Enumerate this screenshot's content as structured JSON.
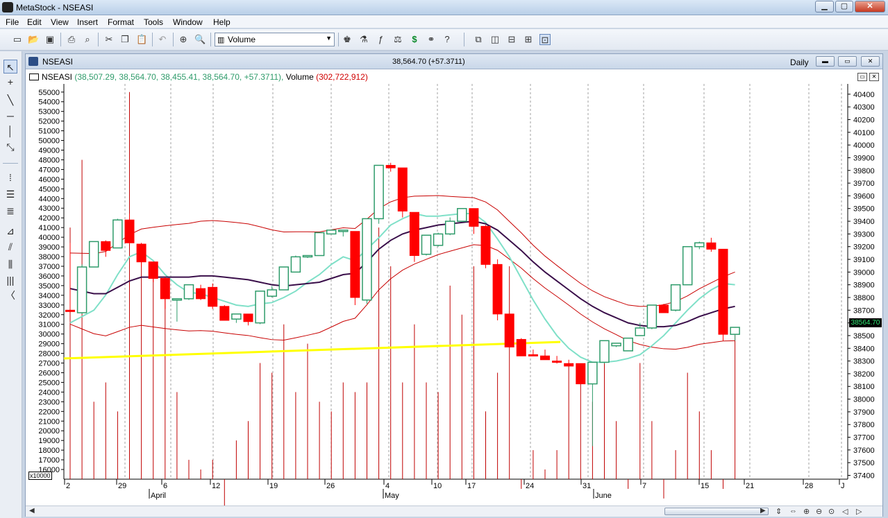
{
  "window": {
    "title": "MetaStock - NSEASI",
    "minimize_label": "▁",
    "maximize_label": "▢",
    "close_label": "✕"
  },
  "menu": [
    "File",
    "Edit",
    "View",
    "Insert",
    "Format",
    "Tools",
    "Window",
    "Help"
  ],
  "toolbar": {
    "indicator_select": "Volume",
    "icons": [
      "new-icon",
      "open-icon",
      "save-icon",
      "print-icon",
      "print-preview-icon",
      "cut-icon",
      "copy-icon",
      "paste-icon",
      "undo-icon",
      "crosshair-icon",
      "zoom-icon",
      "expert-advisor-icon",
      "explorer-icon",
      "formula-icon",
      "system-tester-icon",
      "dollar-icon",
      "binoculars-icon",
      "help-pointer-icon",
      "cascade-icon",
      "tile-vertical-icon",
      "tile-horizontal-icon",
      "tile-grid-icon",
      "arrange-icon"
    ]
  },
  "sidebar_tools": [
    "pointer-icon",
    "crosshair-tool-icon",
    "trendline-icon",
    "horizontal-line-icon",
    "vertical-line-icon",
    "speed-line-icon",
    "fibonacci-icon",
    "channel-icon",
    "gann-icon",
    "andrews-pitchfork-icon",
    "quadrant-icon",
    "cycle-lines-icon",
    "arc-icon"
  ],
  "chart_window": {
    "security": "NSEASI",
    "quote": "38,564.70 (+57.3711)",
    "period": "Daily",
    "legend": {
      "name": "NSEASI",
      "ohlc": "(38,507.29, 38,564.70, 38,455.41, 38,564.70, +57.3711),",
      "volume_label": "Volume",
      "volume_value": "(302,722,912)"
    },
    "last_price_tag": "38564.70",
    "volume_scale_label": "x10000"
  },
  "colors": {
    "up_candle": "#2e9b6a",
    "down_candle": "#ff0000",
    "volume": "#c00000",
    "bollinger": "#c80000",
    "ma_fast": "#7fe0c8",
    "ma_slow": "#3a0f4a",
    "trendline": "#ffff00",
    "grid": "#a0a0a0"
  },
  "chart_data": {
    "type": "candlestick",
    "left_axis": {
      "label": "Volume (x10000)",
      "ticks": [
        55000,
        54000,
        53000,
        52000,
        51000,
        50000,
        49000,
        48000,
        47000,
        46000,
        45000,
        44000,
        43000,
        42000,
        41000,
        40000,
        39000,
        38000,
        37000,
        36000,
        35000,
        34000,
        33000,
        32000,
        31000,
        30000,
        29000,
        28000,
        27000,
        26000,
        25000,
        24000,
        23000,
        22000,
        21000,
        20000,
        19000,
        18000,
        17000,
        16000
      ]
    },
    "right_axis": {
      "label": "Price",
      "ticks": [
        40400,
        40300,
        40200,
        40100,
        40000,
        39900,
        39800,
        39700,
        39600,
        39500,
        39400,
        39300,
        39200,
        39100,
        39000,
        38900,
        38800,
        38700,
        38600,
        38500,
        38400,
        38300,
        38200,
        38100,
        38000,
        37900,
        37800,
        37700,
        37600,
        37500,
        37400
      ]
    },
    "x_ticks": [
      "2",
      "29",
      "6",
      "12",
      "19",
      "26",
      "4",
      "10",
      "17",
      "24",
      "31",
      "7",
      "15",
      "21",
      "28",
      "J"
    ],
    "month_labels": [
      "April",
      "May",
      "June"
    ],
    "candles": [
      {
        "o": 38700,
        "h": 39230,
        "l": 38700,
        "c": 38690
      },
      {
        "o": 38680,
        "h": 39060,
        "l": 38670,
        "c": 39040
      },
      {
        "o": 39040,
        "h": 39120,
        "l": 39040,
        "c": 39240
      },
      {
        "o": 39240,
        "h": 39250,
        "l": 39120,
        "c": 39170
      },
      {
        "o": 39190,
        "h": 39420,
        "l": 39190,
        "c": 39410
      },
      {
        "o": 39410,
        "h": 39460,
        "l": 39220,
        "c": 39230
      },
      {
        "o": 39220,
        "h": 39230,
        "l": 39040,
        "c": 39080
      },
      {
        "o": 39080,
        "h": 39080,
        "l": 38920,
        "c": 38950
      },
      {
        "o": 38950,
        "h": 38960,
        "l": 38710,
        "c": 38790
      },
      {
        "o": 38790,
        "h": 38790,
        "l": 38610,
        "c": 38790
      },
      {
        "o": 38790,
        "h": 38900,
        "l": 38780,
        "c": 38900
      },
      {
        "o": 38870,
        "h": 38900,
        "l": 38780,
        "c": 38790
      },
      {
        "o": 38880,
        "h": 38910,
        "l": 38710,
        "c": 38730
      },
      {
        "o": 38730,
        "h": 38740,
        "l": 38620,
        "c": 38620
      },
      {
        "o": 38630,
        "h": 38660,
        "l": 38600,
        "c": 38670
      },
      {
        "o": 38670,
        "h": 38670,
        "l": 38580,
        "c": 38610
      },
      {
        "o": 38600,
        "h": 38850,
        "l": 38590,
        "c": 38850
      },
      {
        "o": 38810,
        "h": 38890,
        "l": 38800,
        "c": 38860
      },
      {
        "o": 38860,
        "h": 39040,
        "l": 38860,
        "c": 39040
      },
      {
        "o": 39000,
        "h": 39130,
        "l": 39000,
        "c": 39120
      },
      {
        "o": 39120,
        "h": 39130,
        "l": 39110,
        "c": 39130
      },
      {
        "o": 39130,
        "h": 39310,
        "l": 39130,
        "c": 39310
      },
      {
        "o": 39300,
        "h": 39330,
        "l": 39310,
        "c": 39330
      },
      {
        "o": 39330,
        "h": 39330,
        "l": 39280,
        "c": 39330
      },
      {
        "o": 39320,
        "h": 39320,
        "l": 38740,
        "c": 38800
      },
      {
        "o": 38780,
        "h": 39420,
        "l": 38750,
        "c": 39420
      },
      {
        "o": 39420,
        "h": 39830,
        "l": 39380,
        "c": 39840
      },
      {
        "o": 39840,
        "h": 39860,
        "l": 39790,
        "c": 39820
      },
      {
        "o": 39820,
        "h": 39820,
        "l": 39430,
        "c": 39480
      },
      {
        "o": 39470,
        "h": 39470,
        "l": 39080,
        "c": 39130
      },
      {
        "o": 39140,
        "h": 39290,
        "l": 39130,
        "c": 39290
      },
      {
        "o": 39210,
        "h": 39310,
        "l": 39200,
        "c": 39300
      },
      {
        "o": 39300,
        "h": 39430,
        "l": 39290,
        "c": 39400
      },
      {
        "o": 39400,
        "h": 39500,
        "l": 39400,
        "c": 39500
      },
      {
        "o": 39500,
        "h": 39500,
        "l": 39300,
        "c": 39360
      },
      {
        "o": 39360,
        "h": 39370,
        "l": 39030,
        "c": 39060
      },
      {
        "o": 39060,
        "h": 39100,
        "l": 38620,
        "c": 38670
      },
      {
        "o": 38670,
        "h": 38670,
        "l": 38450,
        "c": 38410
      },
      {
        "o": 38470,
        "h": 38480,
        "l": 38340,
        "c": 38340
      },
      {
        "o": 38350,
        "h": 38390,
        "l": 38340,
        "c": 38340
      },
      {
        "o": 38340,
        "h": 38390,
        "l": 38310,
        "c": 38310
      },
      {
        "o": 38300,
        "h": 38340,
        "l": 38280,
        "c": 38290
      },
      {
        "o": 38280,
        "h": 38310,
        "l": 38270,
        "c": 38260
      },
      {
        "o": 38280,
        "h": 38280,
        "l": 38170,
        "c": 38120
      },
      {
        "o": 38120,
        "h": 38150,
        "l": 37630,
        "c": 38290
      },
      {
        "o": 38290,
        "h": 38420,
        "l": 38280,
        "c": 38460
      },
      {
        "o": 38420,
        "h": 38440,
        "l": 38410,
        "c": 38440
      },
      {
        "o": 38380,
        "h": 38410,
        "l": 38380,
        "c": 38480
      },
      {
        "o": 38500,
        "h": 38600,
        "l": 38500,
        "c": 38560
      },
      {
        "o": 38560,
        "h": 38720,
        "l": 38550,
        "c": 38740
      },
      {
        "o": 38740,
        "h": 38750,
        "l": 38680,
        "c": 38680
      },
      {
        "o": 38700,
        "h": 38900,
        "l": 38690,
        "c": 38900
      },
      {
        "o": 38900,
        "h": 39170,
        "l": 38900,
        "c": 39200
      },
      {
        "o": 39200,
        "h": 39240,
        "l": 39180,
        "c": 39230
      },
      {
        "o": 39230,
        "h": 39270,
        "l": 39160,
        "c": 39180
      },
      {
        "o": 39180,
        "h": 39180,
        "l": 38460,
        "c": 38510
      },
      {
        "o": 38510,
        "h": 38560,
        "l": 38460,
        "c": 38565
      }
    ],
    "volume": [
      41000,
      48000,
      23000,
      25000,
      22000,
      55000,
      38000,
      36000,
      34000,
      24000,
      17000,
      16000,
      17000,
      12000,
      19000,
      21000,
      27000,
      26000,
      31000,
      24000,
      29000,
      23000,
      22000,
      25000,
      24000,
      25000,
      41000,
      37000,
      25000,
      31000,
      25000,
      24000,
      35000,
      32000,
      37000,
      22000,
      26000,
      37000,
      14000,
      18000,
      16000,
      18000,
      27000,
      26000,
      23000,
      29000,
      21000,
      14000,
      27000,
      21000,
      13000,
      18000,
      26000,
      22000,
      18000,
      14000,
      30000
    ],
    "ma_fast": [
      38600,
      38650,
      38700,
      38820,
      38980,
      39120,
      39160,
      39090,
      38980,
      38900,
      38840,
      38830,
      38800,
      38770,
      38740,
      38730,
      38750,
      38760,
      38800,
      38850,
      38920,
      38980,
      39060,
      39120,
      39090,
      39180,
      39270,
      39370,
      39420,
      39460,
      39440,
      39440,
      39450,
      39460,
      39460,
      39390,
      39260,
      39120,
      38950,
      38780,
      38630,
      38500,
      38400,
      38330,
      38290,
      38290,
      38300,
      38320,
      38350,
      38420,
      38500,
      38600,
      38700,
      38790,
      38860,
      38910,
      38900
    ],
    "ma_slow": [
      38870,
      38850,
      38830,
      38830,
      38880,
      38930,
      38960,
      38960,
      38960,
      38960,
      38960,
      38970,
      38970,
      38960,
      38950,
      38940,
      38920,
      38900,
      38890,
      38900,
      38910,
      38920,
      38950,
      38980,
      38990,
      39080,
      39180,
      39250,
      39300,
      39330,
      39350,
      39370,
      39380,
      39390,
      39400,
      39380,
      39330,
      39250,
      39170,
      39080,
      39000,
      38930,
      38860,
      38790,
      38730,
      38680,
      38640,
      38600,
      38580,
      38570,
      38570,
      38580,
      38610,
      38650,
      38680,
      38710,
      38730
    ]
  }
}
